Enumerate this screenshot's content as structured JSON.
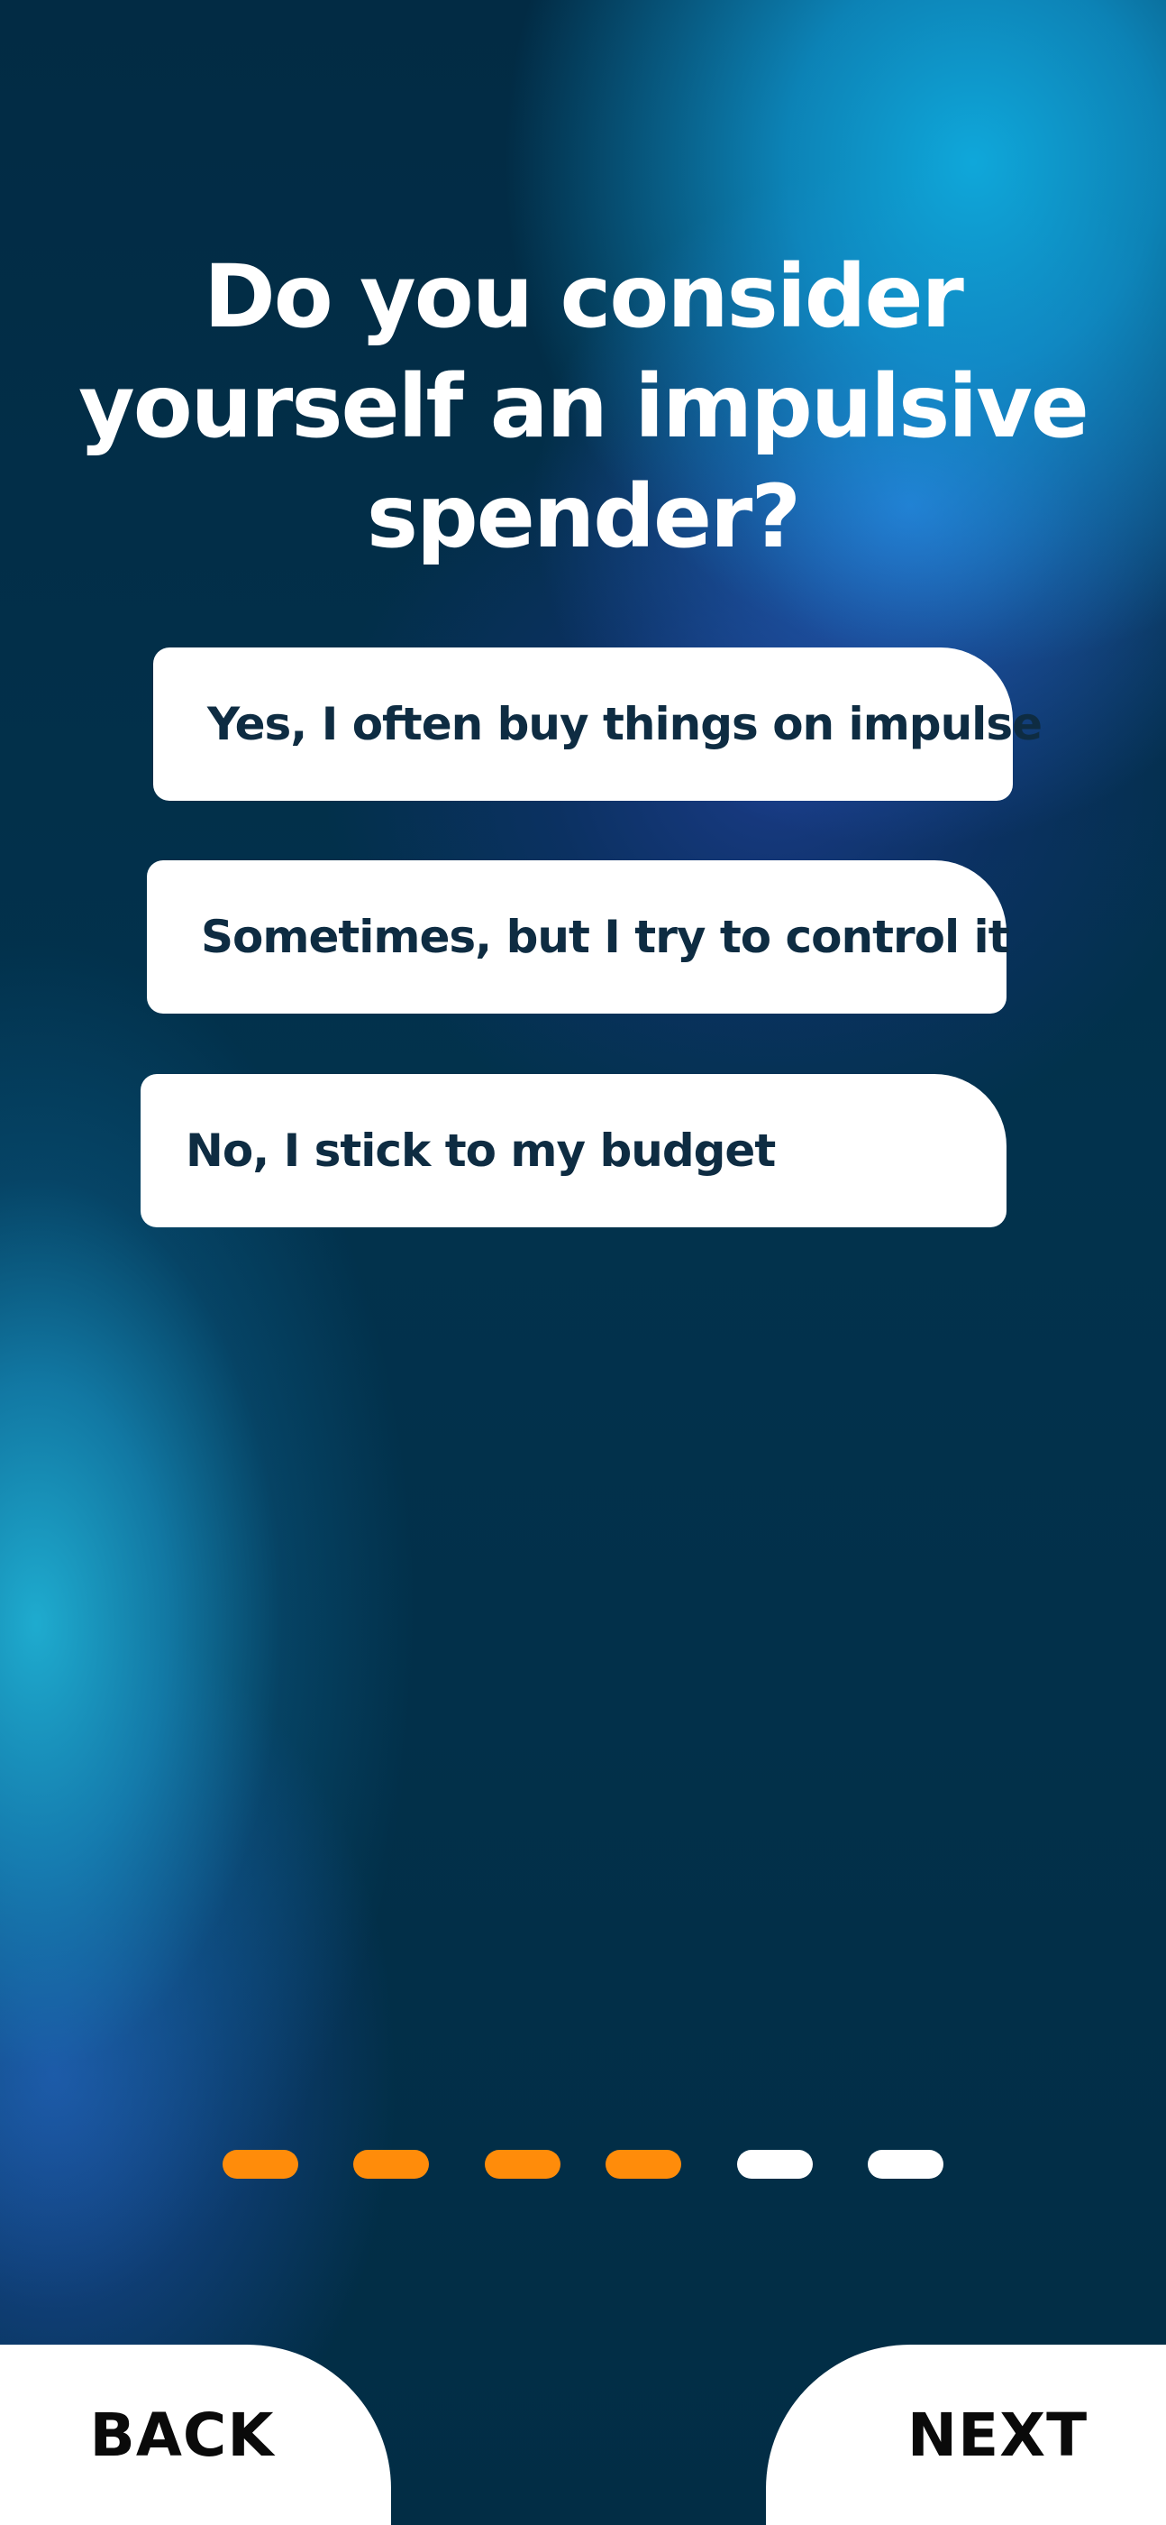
{
  "question": {
    "title": "Do you consider yourself an impulsive spender?"
  },
  "options": [
    {
      "label": "Yes, I often buy things on impulse"
    },
    {
      "label": "Sometimes, but I try to control it"
    },
    {
      "label": "No, I stick to my budget"
    }
  ],
  "progress": {
    "total_steps": 6,
    "completed_steps": 4,
    "active_color": "#FF8C0A",
    "inactive_color": "#FFFFFF"
  },
  "navigation": {
    "back_label": "BACK",
    "next_label": "NEXT"
  }
}
